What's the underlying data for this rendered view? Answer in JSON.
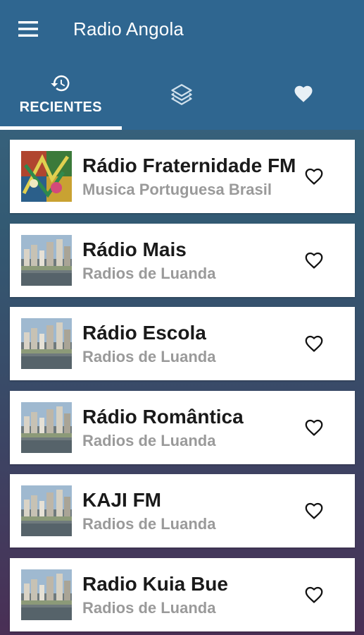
{
  "app": {
    "title": "Radio Angola"
  },
  "tabs": [
    {
      "label": "RECIENTES",
      "icon": "history-icon",
      "active": true
    },
    {
      "label": "",
      "icon": "layers-icon",
      "active": false
    },
    {
      "label": "",
      "icon": "heart-icon",
      "active": false
    }
  ],
  "stations": [
    {
      "name": "Rádio Fraternidade FM",
      "category": "Musica Portuguesa Brasil",
      "thumb": "colorful-art"
    },
    {
      "name": "Rádio Mais",
      "category": "Radios de Luanda",
      "thumb": "city-skyline"
    },
    {
      "name": "Rádio Escola",
      "category": "Radios de Luanda",
      "thumb": "city-skyline"
    },
    {
      "name": "Rádio Romântica",
      "category": "Radios de Luanda",
      "thumb": "city-skyline"
    },
    {
      "name": "KAJI FM",
      "category": "Radios de Luanda",
      "thumb": "city-skyline"
    },
    {
      "name": "Radio Kuia Bue",
      "category": "Radios de Luanda",
      "thumb": "city-skyline"
    }
  ],
  "colors": {
    "primary": "#2f6690",
    "card": "#ffffff",
    "title": "#1a1a1a",
    "subtitle": "#9a9a9a"
  }
}
